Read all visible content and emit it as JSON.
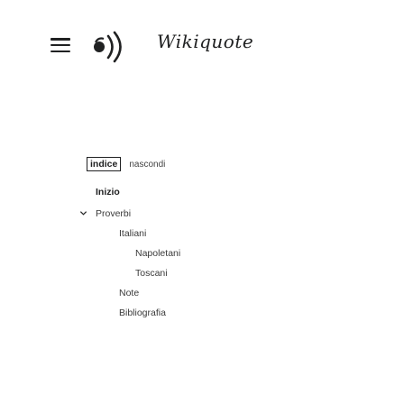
{
  "header": {
    "menu_icon": "hamburger-menu-icon",
    "logo_alt": "Wikiquote",
    "logo_text": "Wikiquote"
  },
  "toc": {
    "tab_index": "indice",
    "tab_hide": "nascondi",
    "items": [
      {
        "label": "Inizio",
        "level": 0,
        "bold": true
      },
      {
        "label": "Proverbi",
        "level": 1,
        "expanded": true
      },
      {
        "label": "Italiani",
        "level": 2
      },
      {
        "label": "Napoletani",
        "level": 3
      },
      {
        "label": "Toscani",
        "level": 3
      },
      {
        "label": "Note",
        "level": 2
      },
      {
        "label": "Bibliografia",
        "level": 2
      }
    ]
  }
}
